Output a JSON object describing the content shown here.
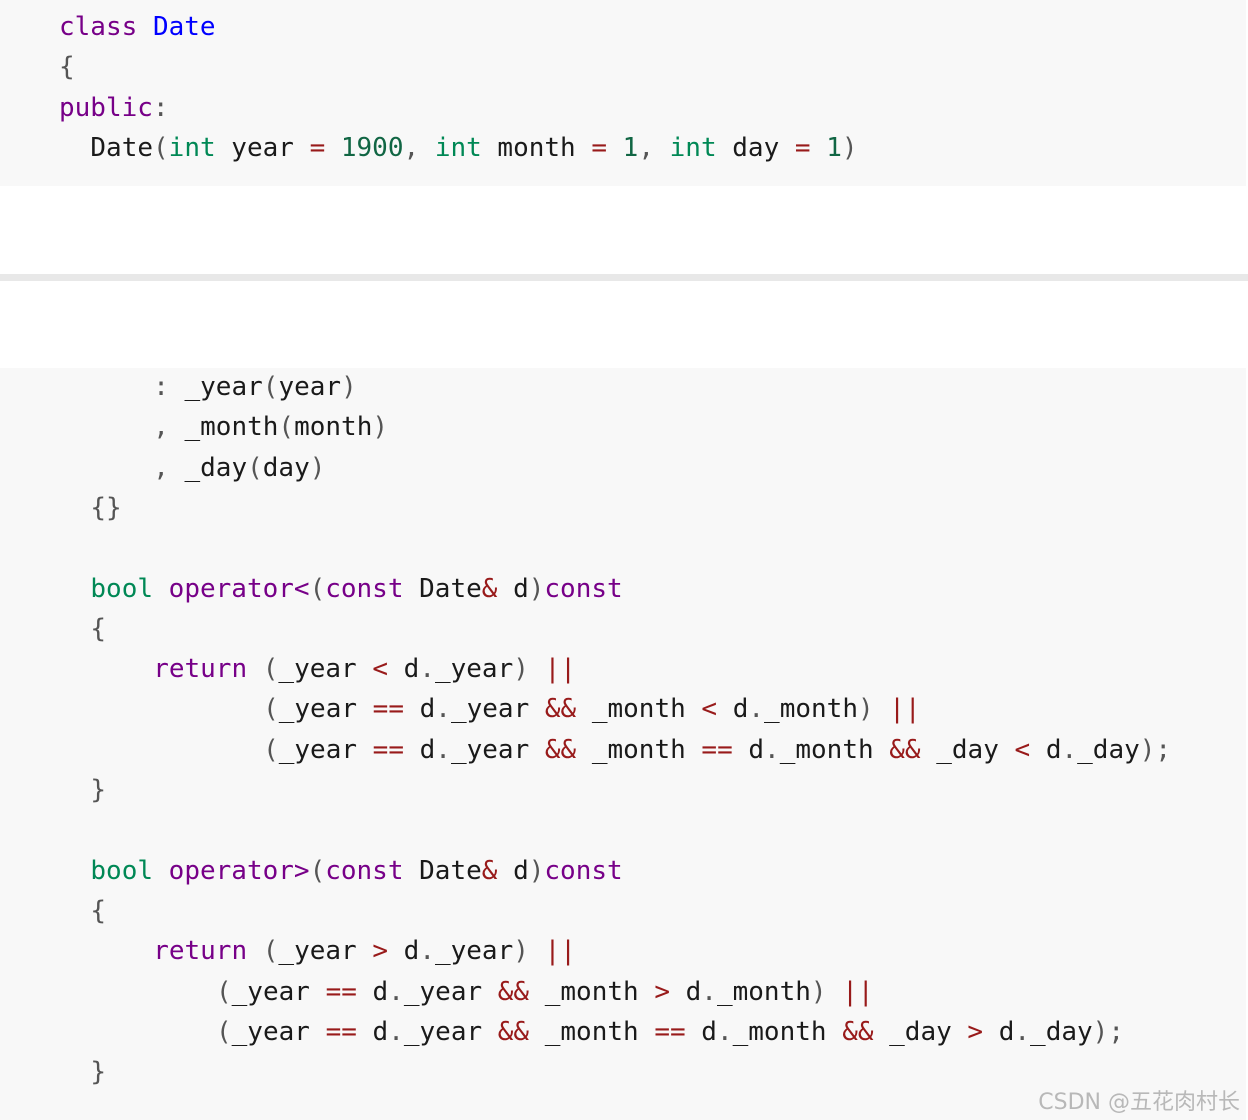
{
  "code_top": [
    {
      "indent": 0,
      "tokens": [
        {
          "t": "class",
          "c": "kw"
        },
        {
          "t": " "
        },
        {
          "t": "Date",
          "c": "def"
        }
      ]
    },
    {
      "indent": 0,
      "tokens": [
        {
          "t": "{",
          "c": "pu"
        }
      ]
    },
    {
      "indent": 0,
      "tokens": [
        {
          "t": "public",
          "c": "kw"
        },
        {
          "t": ":",
          "c": "pu"
        }
      ]
    },
    {
      "indent": 2,
      "tokens": [
        {
          "t": "Date"
        },
        {
          "t": "(",
          "c": "pu"
        },
        {
          "t": "int",
          "c": "ty"
        },
        {
          "t": " year "
        },
        {
          "t": "=",
          "c": "op"
        },
        {
          "t": " "
        },
        {
          "t": "1900",
          "c": "num"
        },
        {
          "t": ", ",
          "c": "pu"
        },
        {
          "t": "int",
          "c": "ty"
        },
        {
          "t": " month "
        },
        {
          "t": "=",
          "c": "op"
        },
        {
          "t": " "
        },
        {
          "t": "1",
          "c": "num"
        },
        {
          "t": ", ",
          "c": "pu"
        },
        {
          "t": "int",
          "c": "ty"
        },
        {
          "t": " day "
        },
        {
          "t": "=",
          "c": "op"
        },
        {
          "t": " "
        },
        {
          "t": "1",
          "c": "num"
        },
        {
          "t": ")",
          "c": "pu"
        }
      ]
    }
  ],
  "code_bottom": [
    {
      "indent": 6,
      "tokens": [
        {
          "t": ": ",
          "c": "pu"
        },
        {
          "t": "_year"
        },
        {
          "t": "(",
          "c": "pu"
        },
        {
          "t": "year"
        },
        {
          "t": ")",
          "c": "pu"
        }
      ]
    },
    {
      "indent": 6,
      "tokens": [
        {
          "t": ", ",
          "c": "pu"
        },
        {
          "t": "_month"
        },
        {
          "t": "(",
          "c": "pu"
        },
        {
          "t": "month"
        },
        {
          "t": ")",
          "c": "pu"
        }
      ]
    },
    {
      "indent": 6,
      "tokens": [
        {
          "t": ", ",
          "c": "pu"
        },
        {
          "t": "_day"
        },
        {
          "t": "(",
          "c": "pu"
        },
        {
          "t": "day"
        },
        {
          "t": ")",
          "c": "pu"
        }
      ]
    },
    {
      "indent": 2,
      "tokens": [
        {
          "t": "{}",
          "c": "pu"
        }
      ]
    },
    {
      "indent": 0,
      "tokens": []
    },
    {
      "indent": 2,
      "tokens": [
        {
          "t": "bool",
          "c": "ty"
        },
        {
          "t": " "
        },
        {
          "t": "operator<",
          "c": "kw"
        },
        {
          "t": "(",
          "c": "pu"
        },
        {
          "t": "const",
          "c": "kw"
        },
        {
          "t": " Date"
        },
        {
          "t": "&",
          "c": "op"
        },
        {
          "t": " d"
        },
        {
          "t": ")",
          "c": "pu"
        },
        {
          "t": "const",
          "c": "kw"
        }
      ]
    },
    {
      "indent": 2,
      "tokens": [
        {
          "t": "{",
          "c": "pu"
        }
      ]
    },
    {
      "indent": 6,
      "tokens": [
        {
          "t": "return",
          "c": "kw"
        },
        {
          "t": " "
        },
        {
          "t": "(",
          "c": "pu"
        },
        {
          "t": "_year "
        },
        {
          "t": "<",
          "c": "op"
        },
        {
          "t": " d"
        },
        {
          "t": ".",
          "c": "pu"
        },
        {
          "t": "_year"
        },
        {
          "t": ")",
          "c": "pu"
        },
        {
          "t": " "
        },
        {
          "t": "||",
          "c": "op"
        }
      ]
    },
    {
      "indent": 13,
      "tokens": [
        {
          "t": "(",
          "c": "pu"
        },
        {
          "t": "_year "
        },
        {
          "t": "==",
          "c": "op"
        },
        {
          "t": " d"
        },
        {
          "t": ".",
          "c": "pu"
        },
        {
          "t": "_year "
        },
        {
          "t": "&&",
          "c": "op"
        },
        {
          "t": " _month "
        },
        {
          "t": "<",
          "c": "op"
        },
        {
          "t": " d"
        },
        {
          "t": ".",
          "c": "pu"
        },
        {
          "t": "_month"
        },
        {
          "t": ")",
          "c": "pu"
        },
        {
          "t": " "
        },
        {
          "t": "||",
          "c": "op"
        }
      ]
    },
    {
      "indent": 13,
      "tokens": [
        {
          "t": "(",
          "c": "pu"
        },
        {
          "t": "_year "
        },
        {
          "t": "==",
          "c": "op"
        },
        {
          "t": " d"
        },
        {
          "t": ".",
          "c": "pu"
        },
        {
          "t": "_year "
        },
        {
          "t": "&&",
          "c": "op"
        },
        {
          "t": " _month "
        },
        {
          "t": "==",
          "c": "op"
        },
        {
          "t": " d"
        },
        {
          "t": ".",
          "c": "pu"
        },
        {
          "t": "_month "
        },
        {
          "t": "&&",
          "c": "op"
        },
        {
          "t": " _day "
        },
        {
          "t": "<",
          "c": "op"
        },
        {
          "t": " d"
        },
        {
          "t": ".",
          "c": "pu"
        },
        {
          "t": "_day"
        },
        {
          "t": ");",
          "c": "pu"
        }
      ]
    },
    {
      "indent": 2,
      "tokens": [
        {
          "t": "}",
          "c": "pu"
        }
      ]
    },
    {
      "indent": 0,
      "tokens": []
    },
    {
      "indent": 2,
      "tokens": [
        {
          "t": "bool",
          "c": "ty"
        },
        {
          "t": " "
        },
        {
          "t": "operator>",
          "c": "kw"
        },
        {
          "t": "(",
          "c": "pu"
        },
        {
          "t": "const",
          "c": "kw"
        },
        {
          "t": " Date"
        },
        {
          "t": "&",
          "c": "op"
        },
        {
          "t": " d"
        },
        {
          "t": ")",
          "c": "pu"
        },
        {
          "t": "const",
          "c": "kw"
        }
      ]
    },
    {
      "indent": 2,
      "tokens": [
        {
          "t": "{",
          "c": "pu"
        }
      ]
    },
    {
      "indent": 6,
      "tokens": [
        {
          "t": "return",
          "c": "kw"
        },
        {
          "t": " "
        },
        {
          "t": "(",
          "c": "pu"
        },
        {
          "t": "_year "
        },
        {
          "t": ">",
          "c": "op"
        },
        {
          "t": " d"
        },
        {
          "t": ".",
          "c": "pu"
        },
        {
          "t": "_year"
        },
        {
          "t": ")",
          "c": "pu"
        },
        {
          "t": " "
        },
        {
          "t": "||",
          "c": "op"
        }
      ]
    },
    {
      "indent": 10,
      "tokens": [
        {
          "t": "(",
          "c": "pu"
        },
        {
          "t": "_year "
        },
        {
          "t": "==",
          "c": "op"
        },
        {
          "t": " d"
        },
        {
          "t": ".",
          "c": "pu"
        },
        {
          "t": "_year "
        },
        {
          "t": "&&",
          "c": "op"
        },
        {
          "t": " _month "
        },
        {
          "t": ">",
          "c": "op"
        },
        {
          "t": " d"
        },
        {
          "t": ".",
          "c": "pu"
        },
        {
          "t": "_month"
        },
        {
          "t": ")",
          "c": "pu"
        },
        {
          "t": " "
        },
        {
          "t": "||",
          "c": "op"
        }
      ]
    },
    {
      "indent": 10,
      "tokens": [
        {
          "t": "(",
          "c": "pu"
        },
        {
          "t": "_year "
        },
        {
          "t": "==",
          "c": "op"
        },
        {
          "t": " d"
        },
        {
          "t": ".",
          "c": "pu"
        },
        {
          "t": "_year "
        },
        {
          "t": "&&",
          "c": "op"
        },
        {
          "t": " _month "
        },
        {
          "t": "==",
          "c": "op"
        },
        {
          "t": " d"
        },
        {
          "t": ".",
          "c": "pu"
        },
        {
          "t": "_month "
        },
        {
          "t": "&&",
          "c": "op"
        },
        {
          "t": " _day "
        },
        {
          "t": ">",
          "c": "op"
        },
        {
          "t": " d"
        },
        {
          "t": ".",
          "c": "pu"
        },
        {
          "t": "_day"
        },
        {
          "t": ");",
          "c": "pu"
        }
      ]
    },
    {
      "indent": 2,
      "tokens": [
        {
          "t": "}",
          "c": "pu"
        }
      ]
    }
  ],
  "watermark": "CSDN @五花肉村长"
}
